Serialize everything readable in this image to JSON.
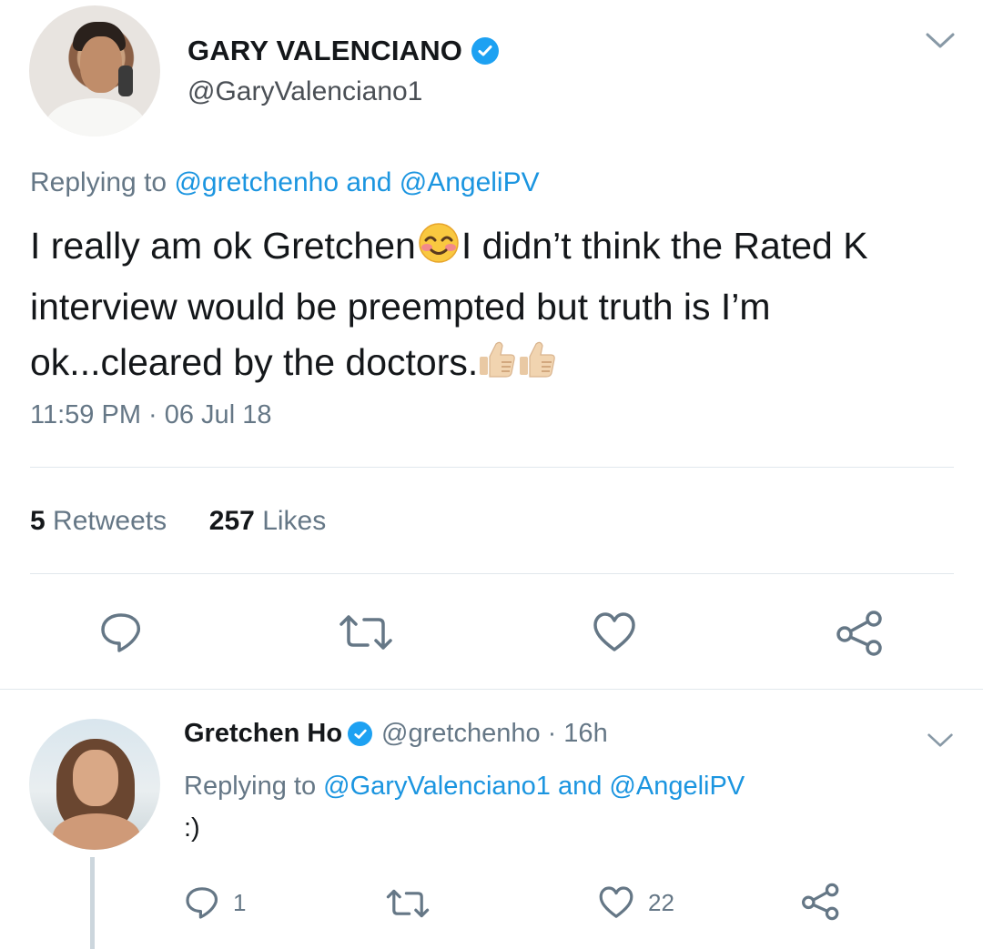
{
  "tweet": {
    "author_name": "GARY VALENCIANO",
    "author_handle": "@GaryValenciano1",
    "replying_prefix": "Replying to ",
    "reply_to_1": "@gretchenho",
    "reply_joiner": " and ",
    "reply_to_2": "@AngeliPV",
    "text_part1": "I really am ok Gretchen",
    "text_part2": "I didn’t think the Rated K interview would be preempted but truth is I’m ok...cleared by the doctors.",
    "timestamp": "11:59 PM · 06 Jul 18",
    "retweets_count": "5",
    "retweets_label": "Retweets",
    "likes_count": "257",
    "likes_label": "Likes"
  },
  "reply": {
    "author_name": "Gretchen Ho",
    "author_handle": "@gretchenho",
    "time_ago": "· 16h",
    "replying_prefix": "Replying to ",
    "reply_to_1": "@GaryValenciano1",
    "reply_joiner": " and ",
    "reply_to_2": "@AngeliPV",
    "text": ":)",
    "reply_count": "1",
    "like_count": "22"
  },
  "icons": {
    "verified": "verified-badge-icon",
    "more": "chevron-down-icon",
    "reply": "comment-icon",
    "retweet": "retweet-icon",
    "like": "heart-icon",
    "share": "share-icon",
    "emoji_smile": "smiling-face-icon",
    "emoji_thumbs": "thumbs-up-icon"
  },
  "colors": {
    "link": "#1b95e0",
    "verified": "#1da1f2",
    "secondary_text": "#657786",
    "divider": "#e1e8ed"
  }
}
